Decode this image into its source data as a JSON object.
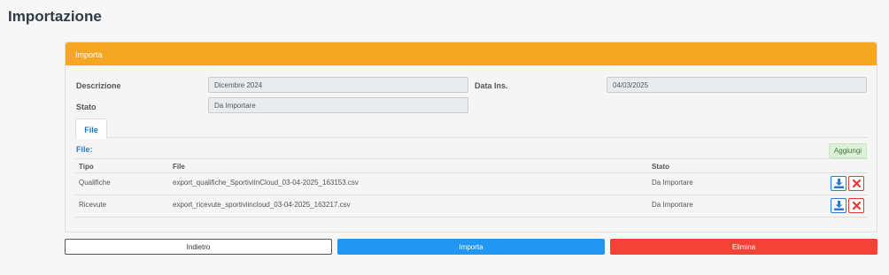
{
  "page": {
    "title": "Importazione"
  },
  "panel": {
    "header": "Importa",
    "fields": {
      "descrizione_label": "Descrizione",
      "descrizione_value": "Dicembre 2024",
      "data_ins_label": "Data Ins.",
      "data_ins_value": "04/03/2025",
      "stato_label": "Stato",
      "stato_value": "Da Importare"
    },
    "tabs": [
      {
        "label": "File",
        "active": true
      }
    ],
    "file_section": {
      "label": "File:",
      "add_button": "Aggiungi",
      "columns": [
        "Tipo",
        "File",
        "Stato"
      ],
      "rows": [
        {
          "tipo": "Qualifiche",
          "file": "export_qualifiche_SportiviInCloud_03-04-2025_163153.csv",
          "stato": "Da Importare"
        },
        {
          "tipo": "Ricevute",
          "file": "export_ricevute_sportiviincloud_03-04-2025_163217.csv",
          "stato": "Da Importare"
        }
      ]
    }
  },
  "actions": {
    "back": "Indietro",
    "import": "Importa",
    "delete": "Elimina"
  },
  "colors": {
    "header": "#f5a623",
    "primary": "#2196f3",
    "danger": "#f44336",
    "success_bg": "#dff0d8"
  }
}
